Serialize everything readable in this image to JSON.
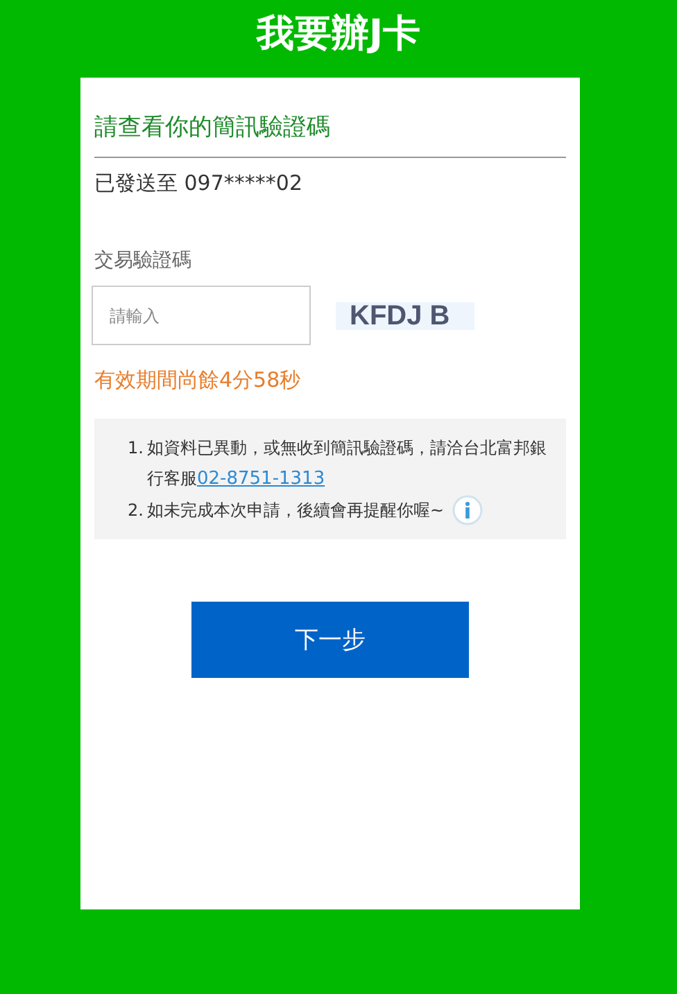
{
  "header": {
    "title": "我要辦J卡"
  },
  "card": {
    "heading": "請查看你的簡訊驗證碼",
    "sent_to": "已發送至 097*****02",
    "code_label": "交易驗證碼",
    "code_field": {
      "placeholder": "請輸入"
    },
    "captcha": "KFDJ B",
    "validity": "有效期間尚餘4分58秒",
    "notes": [
      {
        "number": "1.",
        "text": "如資料已異動，或無收到簡訊驗證碼，請洽台北富邦銀行客服",
        "link": "02-8751-1313"
      },
      {
        "number": "2.",
        "text": "如未完成本次申請，後續會再提醒你喔~",
        "info": true
      }
    ],
    "next_button": "下一步"
  }
}
